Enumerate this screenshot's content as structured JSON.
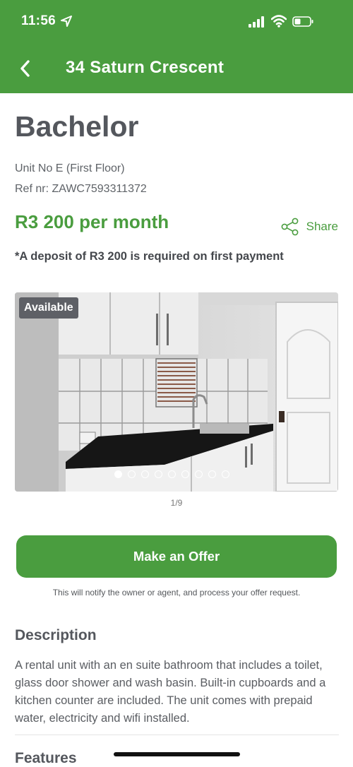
{
  "status_bar": {
    "time": "11:56"
  },
  "header": {
    "title": "34 Saturn Crescent"
  },
  "listing": {
    "unit_type": "Bachelor",
    "unit_no": "Unit No E (First Floor)",
    "ref": "Ref nr: ZAWC7593311372",
    "price": "R3 200 per month",
    "share_label": "Share",
    "deposit_note": "*A deposit of R3 200 is required on first payment"
  },
  "gallery": {
    "badge": "Available",
    "counter": "1/9",
    "total": 9,
    "current": 1
  },
  "offer": {
    "button_label": "Make an Offer",
    "note": "This will notify the owner or agent, and process your offer request."
  },
  "description": {
    "title": "Description",
    "text": "A rental unit with an en suite bathroom that includes a toilet, glass door shower and wash basin. Built-in cupboards and a kitchen counter are included. The unit comes with prepaid water, electricity and wifi installed."
  },
  "features": {
    "title": "Features"
  },
  "colors": {
    "brand_green": "#4a9d3f"
  }
}
